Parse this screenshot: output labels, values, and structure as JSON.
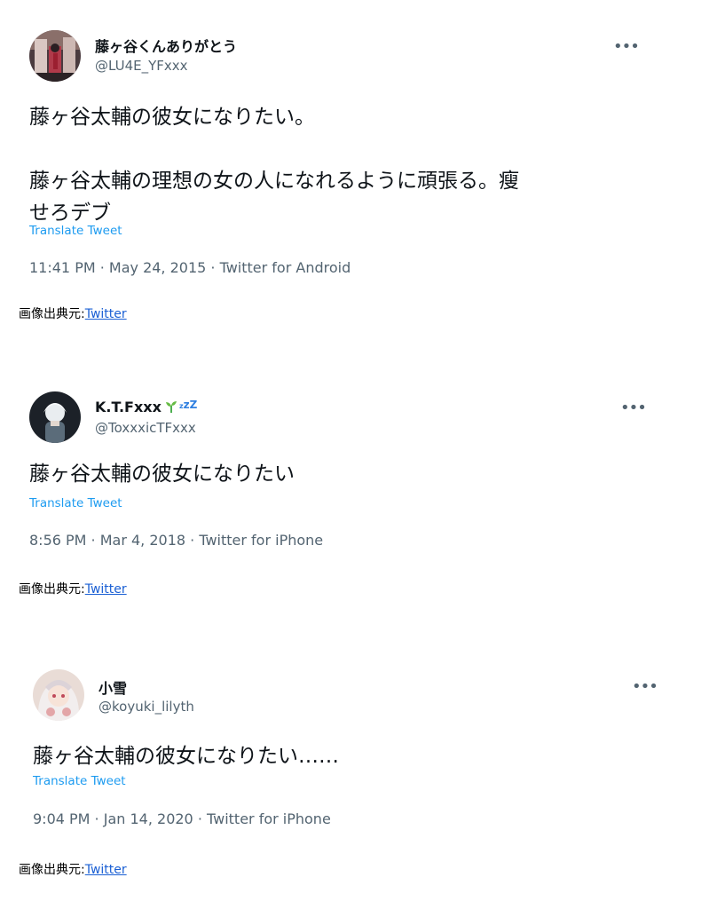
{
  "tweets": [
    {
      "display_name": "藤ヶ谷くんありがとう",
      "handle": "@LU4E_YFxxx",
      "text": "藤ヶ谷太輔の彼女になりたい。\n\n藤ヶ谷太輔の理想の女の人になれるように頑張る。瘦\nせろデブ",
      "translate_label": "Translate Tweet",
      "meta": "11:41 PM · May 24, 2015 · Twitter for Android",
      "more_label": "•••"
    },
    {
      "display_name": "K.T.Fxxx",
      "handle": "@ToxxxicTFxxx",
      "badge_zzz": "zZ",
      "badge_zzz_prefix": "z",
      "text": "藤ヶ谷太輔の彼女になりたい",
      "translate_label": "Translate Tweet",
      "meta": "8:56 PM · Mar 4, 2018 · Twitter for iPhone",
      "more_label": "•••"
    },
    {
      "display_name": "小雪",
      "handle": "@koyuki_lilyth",
      "text": "藤ヶ谷太輔の彼女になりたい……",
      "translate_label": "Translate Tweet",
      "meta": "9:04 PM · Jan 14, 2020 · Twitter for iPhone",
      "more_label": "•••"
    }
  ],
  "credits": [
    {
      "prefix": "画像出典元:",
      "link": "Twitter"
    },
    {
      "prefix": "画像出典元:",
      "link": "Twitter"
    },
    {
      "prefix": "画像出典元:",
      "link": "Twitter"
    }
  ],
  "colors": {
    "text": "#0f1419",
    "secondary": "#536471",
    "translate": "#1d9bf0",
    "link": "#1a5fd4"
  }
}
